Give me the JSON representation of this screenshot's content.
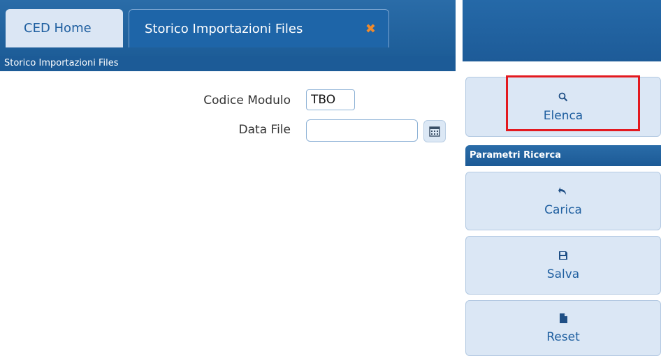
{
  "tabs": [
    {
      "label": "CED Home"
    },
    {
      "label": "Storico Importazioni Files",
      "close": "✖"
    }
  ],
  "subheader": {
    "title": "Storico Importazioni Files"
  },
  "form": {
    "codice_modulo": {
      "label": "Codice Modulo",
      "value": "TBO"
    },
    "data_file": {
      "label": "Data File",
      "value": ""
    }
  },
  "right_panel": {
    "elenca": {
      "icon": "search-icon",
      "label": "Elenca"
    },
    "section_title": "Parametri Ricerca",
    "carica": {
      "icon": "undo-arrow-icon",
      "label": "Carica"
    },
    "salva": {
      "icon": "save-icon",
      "label": "Salva"
    },
    "reset": {
      "icon": "file-icon",
      "label": "Reset"
    }
  },
  "colors": {
    "header_blue": "#1e65a8",
    "highlight": "#e3191f",
    "close": "#f08a2c"
  }
}
